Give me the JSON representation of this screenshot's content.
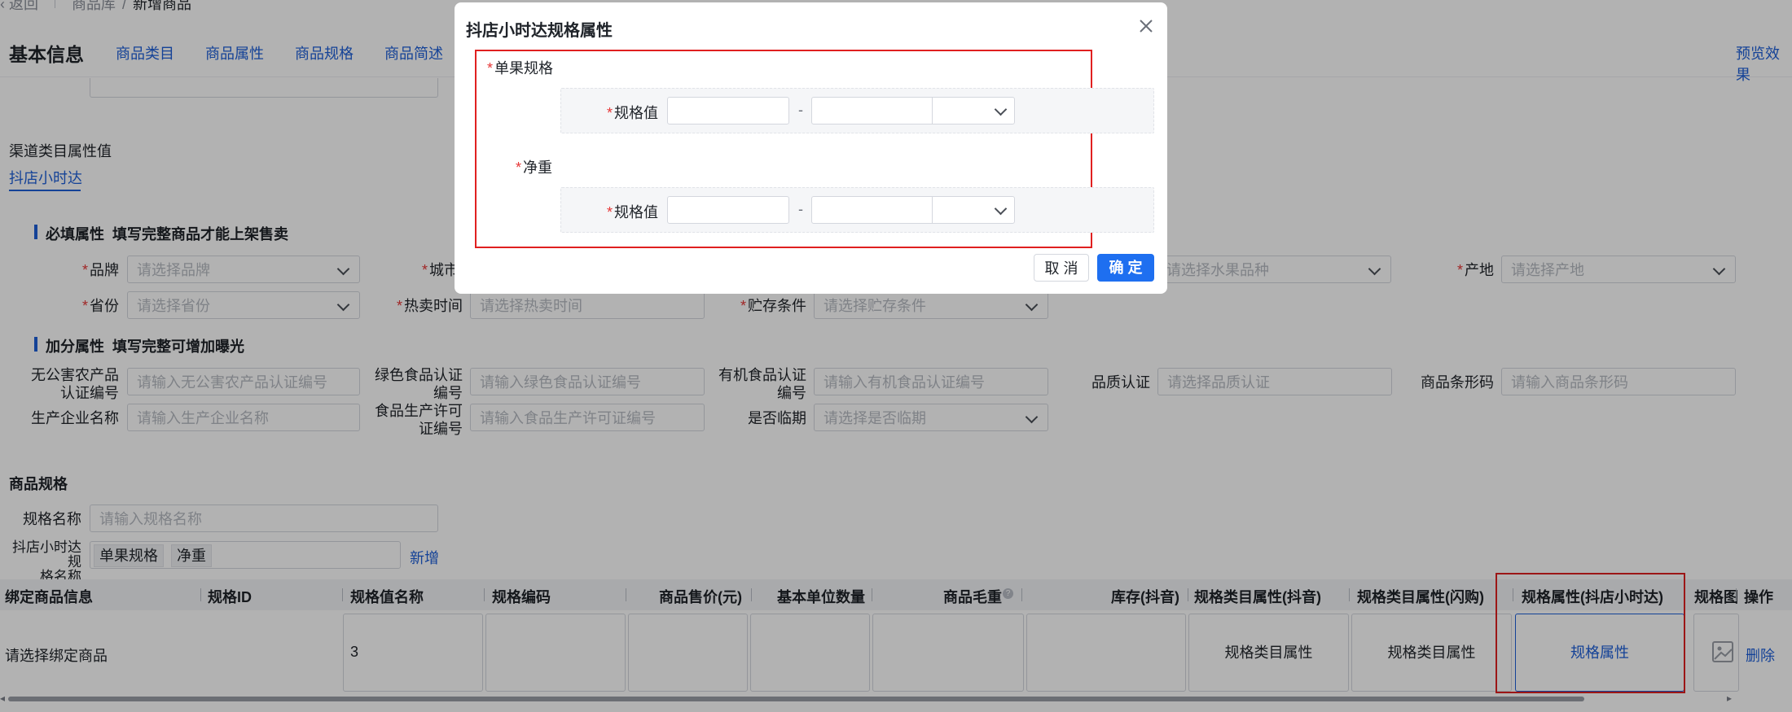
{
  "breadcrumb": {
    "back": "返回",
    "level1": "商品库",
    "sep": "/",
    "current": "新增商品"
  },
  "tabs": {
    "title": "基本信息",
    "items": [
      "商品类目",
      "商品属性",
      "商品规格",
      "商品简述"
    ],
    "preview": "预览效果"
  },
  "channel": {
    "label": "渠道类目属性值",
    "tab": "抖店小时达"
  },
  "required_section": {
    "title": "必填属性",
    "hint": "填写完整商品才能上架售卖",
    "brand": {
      "label": "品牌",
      "placeholder": "请选择品牌"
    },
    "city": {
      "label": "城市"
    },
    "fruit": {
      "placeholder": "请选择水果品种"
    },
    "origin": {
      "label": "产地",
      "placeholder": "请选择产地"
    },
    "province": {
      "label": "省份",
      "placeholder": "请选择省份"
    },
    "hot_time": {
      "label": "热卖时间",
      "placeholder": "请选择热卖时间"
    },
    "storage": {
      "label": "贮存条件",
      "placeholder": "请选择贮存条件"
    }
  },
  "bonus_section": {
    "title": "加分属性",
    "hint": "填写完整可增加曝光",
    "nopollution": {
      "label1": "无公害农产品",
      "label2": "认证编号",
      "placeholder": "请输入无公害农产品认证编号"
    },
    "green": {
      "label1": "绿色食品认证",
      "label2": "编号",
      "placeholder": "请输入绿色食品认证编号"
    },
    "organic": {
      "label1": "有机食品认证",
      "label2": "编号",
      "placeholder": "请输入有机食品认证编号"
    },
    "quality": {
      "label": "品质认证",
      "placeholder": "请选择品质认证"
    },
    "barcode": {
      "label": "商品条形码",
      "placeholder": "请输入商品条形码"
    },
    "producer": {
      "label": "生产企业名称",
      "placeholder": "请输入生产企业名称"
    },
    "license": {
      "label1": "食品生产许可",
      "label2": "证编号",
      "placeholder": "请输入食品生产许可证编号"
    },
    "expiry": {
      "label": "是否临期",
      "placeholder": "请选择是否临期"
    }
  },
  "spec": {
    "title": "商品规格",
    "name_label": "规格名称",
    "name_placeholder": "请输入规格名称",
    "dd_label1": "抖店小时达规",
    "dd_label2": "格名称",
    "tags": [
      "单果规格",
      "净重"
    ],
    "add": "新增"
  },
  "table": {
    "headers": [
      "绑定商品信息",
      "规格ID",
      "规格值名称",
      "规格编码",
      "商品售价(元)",
      "基本单位数量",
      "商品毛重",
      "库存(抖音)",
      "规格类目属性(抖音)",
      "规格类目属性(闪购)",
      "规格属性(抖店小时达)",
      "规格图",
      "操作"
    ],
    "row": {
      "bind": "请选择绑定商品",
      "spec_value": "3",
      "attr_douyin": "规格类目属性",
      "attr_shangou": "规格类目属性",
      "attr_dd": "规格属性",
      "delete": "删除"
    }
  },
  "modal": {
    "title": "抖店小时达规格属性",
    "groups": [
      {
        "name": "单果规格",
        "field_label": "规格值",
        "dash": "-"
      },
      {
        "name": "净重",
        "field_label": "规格值",
        "dash": "-"
      }
    ],
    "cancel": "取 消",
    "confirm": "确 定"
  },
  "colors": {
    "accent": "#1e5fd9",
    "required": "#e63737",
    "highlight_border": "#e02020"
  }
}
